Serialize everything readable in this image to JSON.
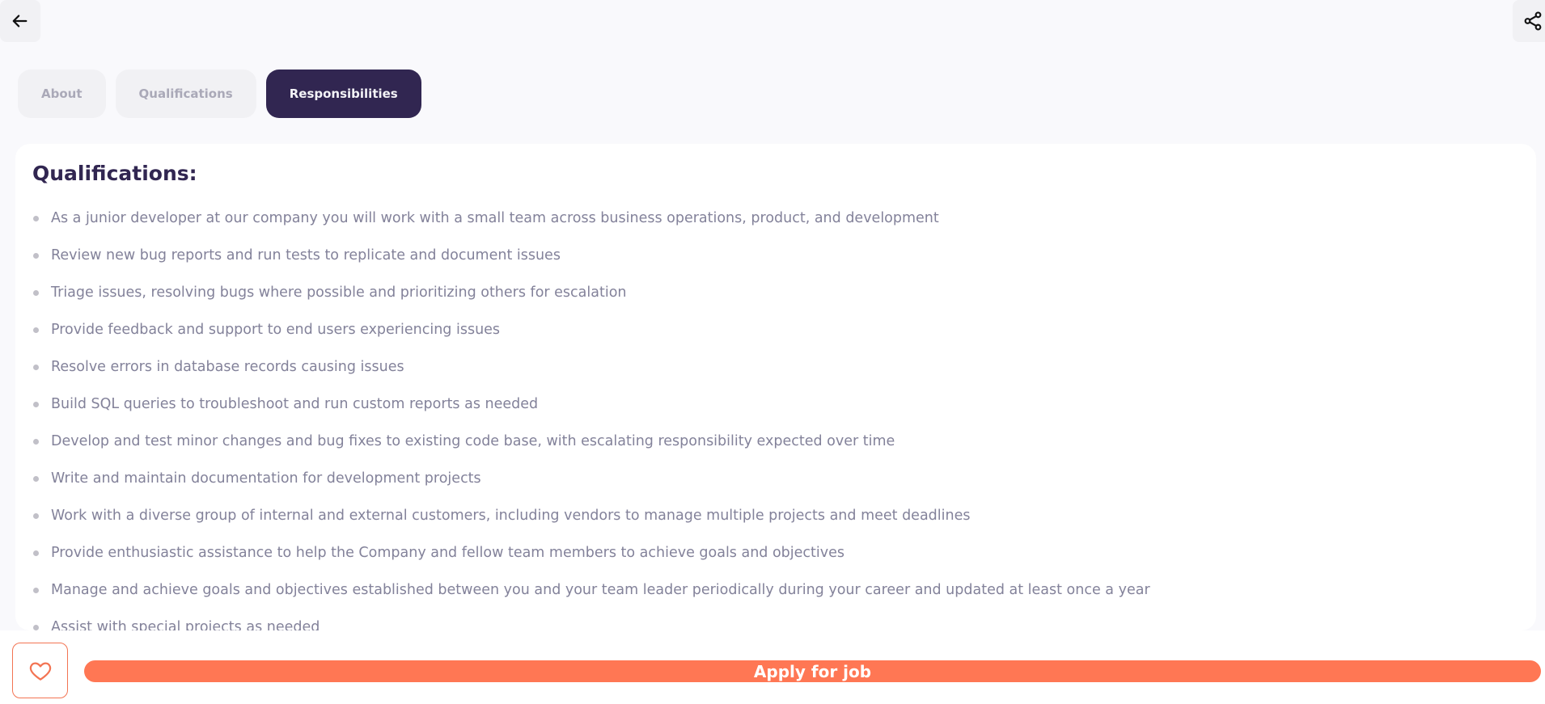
{
  "header": {
    "back_icon": "arrow-left-icon",
    "share_icon": "share-icon"
  },
  "tabs": [
    {
      "label": "About",
      "active": false
    },
    {
      "label": "Qualifications",
      "active": false
    },
    {
      "label": "Responsibilities",
      "active": true
    }
  ],
  "section": {
    "title": "Qualifications:",
    "items": [
      "As a junior developer at our company you will work with a small team across business operations, product, and development",
      "Review new bug reports and run tests to replicate and document issues",
      "Triage issues, resolving bugs where possible and prioritizing others for escalation",
      "Provide feedback and support to end users experiencing issues",
      "Resolve errors in database records causing issues",
      "Build SQL queries to troubleshoot and run custom reports as needed",
      "Develop and test minor changes and bug fixes to existing code base, with escalating responsibility expected over time",
      "Write and maintain documentation for development projects",
      "Work with a diverse group of internal and external customers, including vendors to manage multiple projects and meet deadlines",
      "Provide enthusiastic assistance to help the Company and fellow team members to achieve goals and objectives",
      "Manage and achieve goals and objectives established between you and your team leader periodically during your career and updated at least once a year",
      "Assist with special projects as needed"
    ]
  },
  "footer": {
    "like_icon": "heart-icon",
    "apply_label": "Apply for job"
  },
  "colors": {
    "primary": "#312651",
    "accent": "#ff7754",
    "text_gray": "#83829a",
    "tab_inactive_bg": "#f1f1f4",
    "page_bg": "#f9f9fc"
  }
}
